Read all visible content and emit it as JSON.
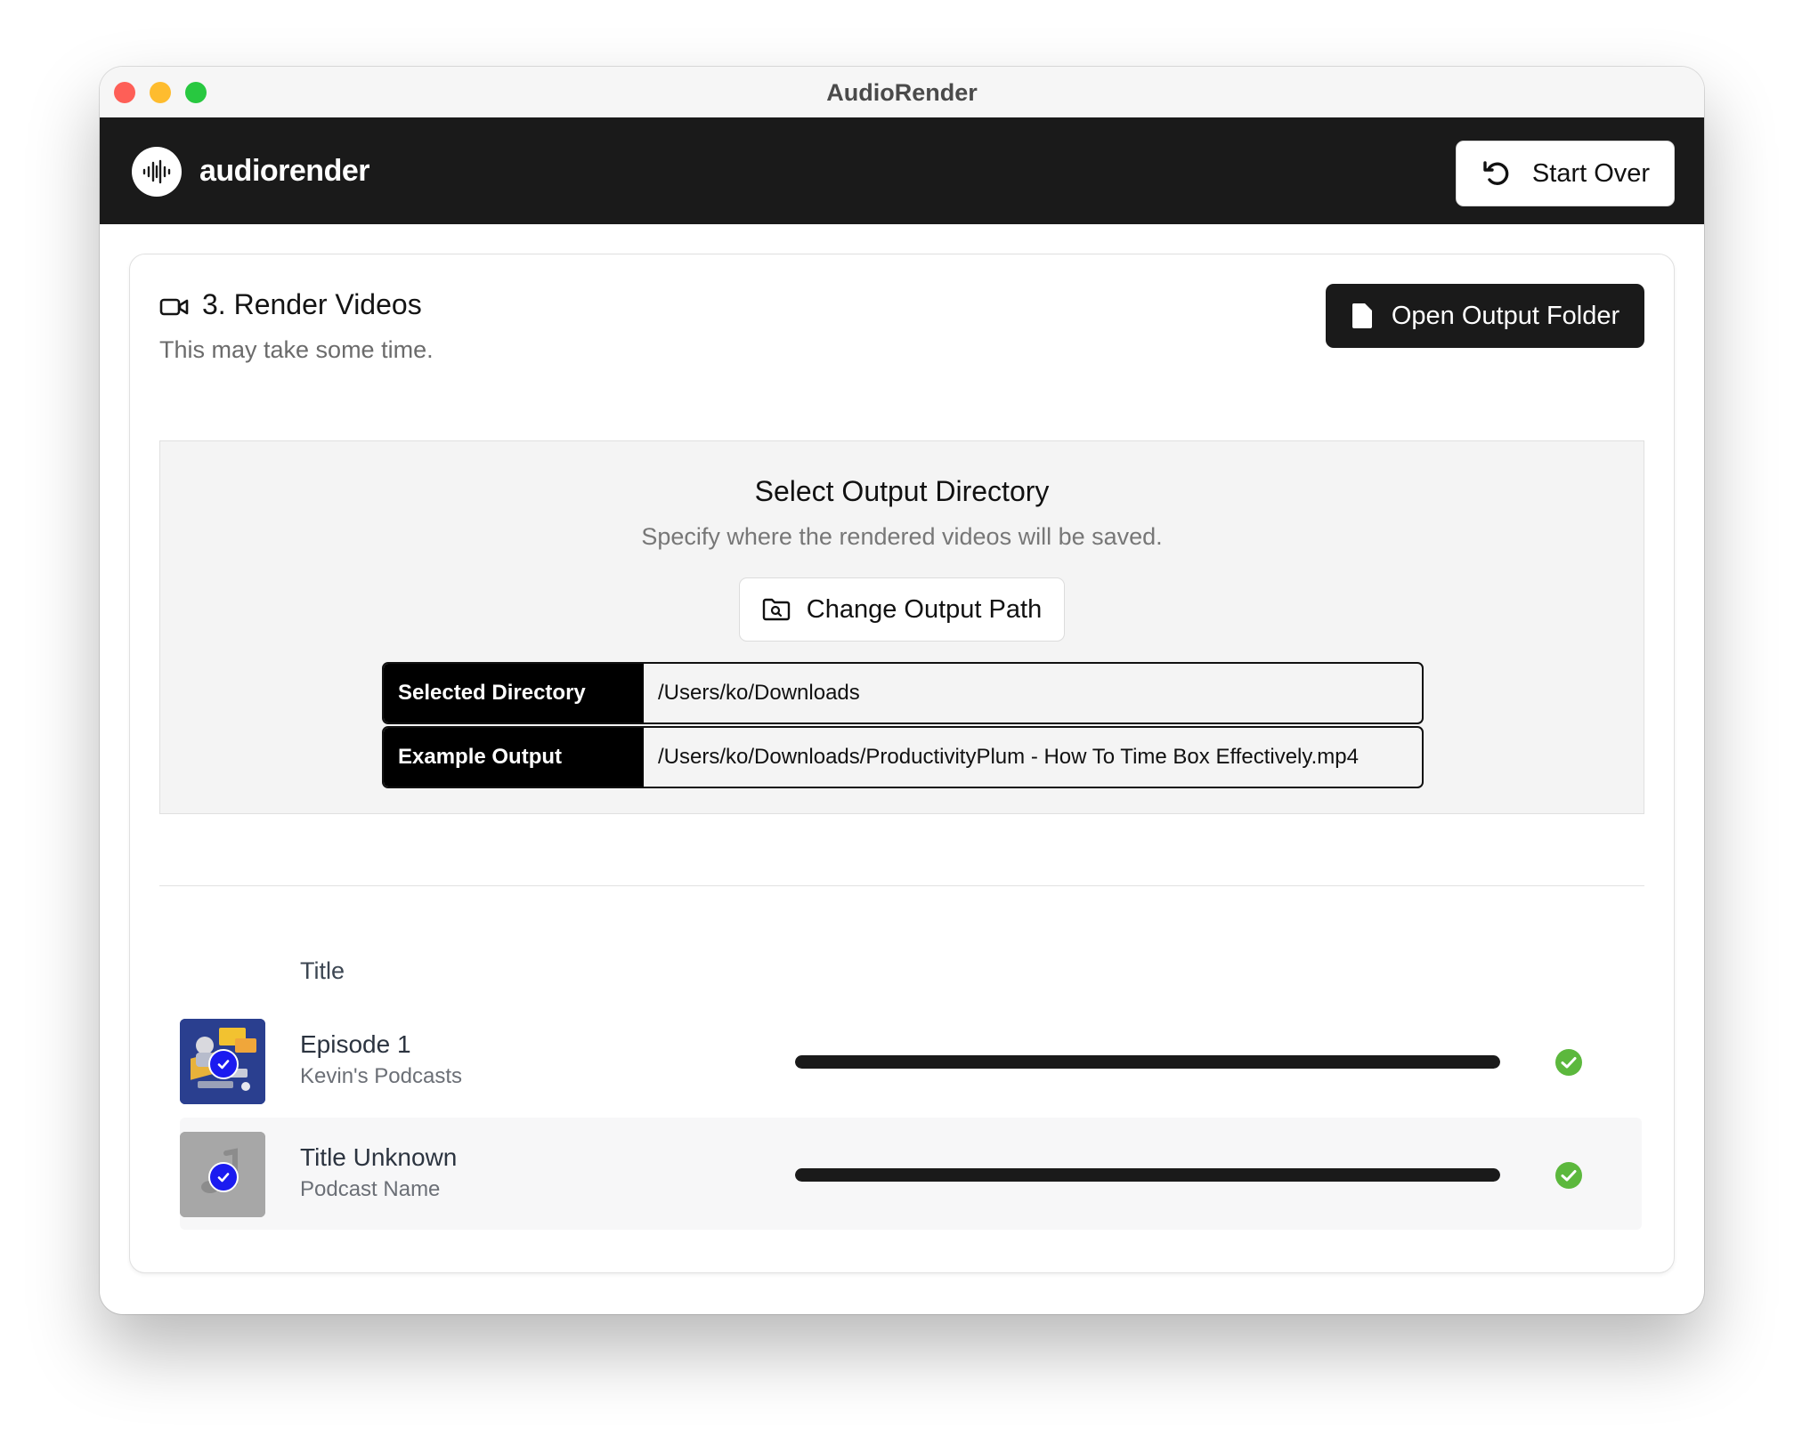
{
  "window": {
    "title": "AudioRender"
  },
  "header": {
    "brand": "audiorender",
    "start_over_label": "Start Over"
  },
  "section": {
    "title": "3. Render Videos",
    "subtitle": "This may take some time.",
    "open_folder_label": "Open Output Folder"
  },
  "output": {
    "title": "Select Output Directory",
    "subtitle": "Specify where the rendered videos will be saved.",
    "change_path_label": "Change Output Path",
    "selected_directory_label": "Selected Directory",
    "selected_directory_value": "/Users/ko/Downloads",
    "example_output_label": "Example Output",
    "example_output_value": "/Users/ko/Downloads/ProductivityPlum - How To Time Box Effectively.mp4"
  },
  "list": {
    "column_title": "Title",
    "items": [
      {
        "title": "Episode 1",
        "subtitle": "Kevin's Podcasts",
        "progress": 1.0,
        "status": "complete",
        "thumbnail": "podcast-artwork"
      },
      {
        "title": "Title Unknown",
        "subtitle": "Podcast Name",
        "progress": 1.0,
        "status": "complete",
        "thumbnail": "placeholder-artwork"
      }
    ]
  },
  "colors": {
    "header_bg": "#1a1a1a",
    "success": "#5cb83d",
    "selected_badge": "#1b1bf0"
  }
}
